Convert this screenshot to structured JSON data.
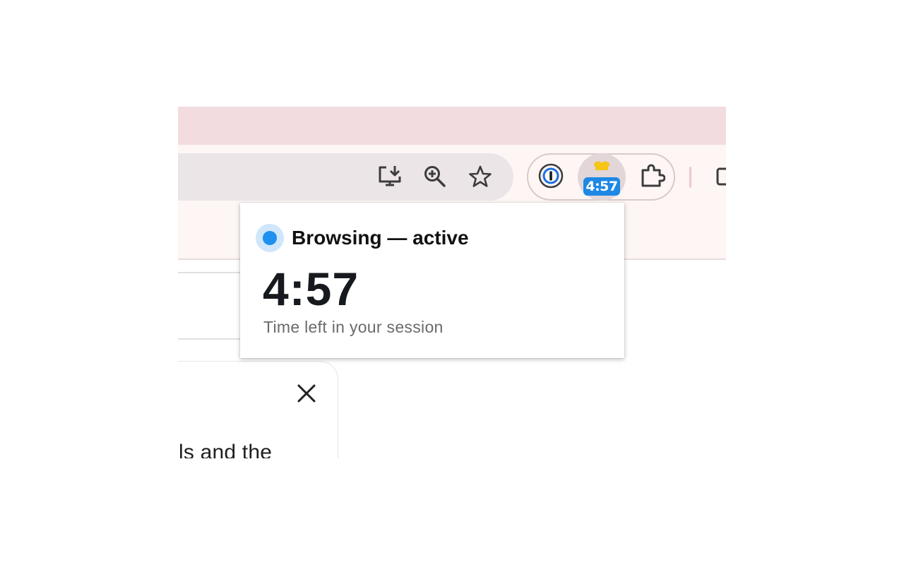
{
  "toolbar": {
    "icons": [
      "install-app-icon",
      "zoom-in-icon",
      "bookmark-star-icon"
    ],
    "extensions": [
      "1password-icon",
      "session-timer-extension",
      "extensions-puzzle-icon"
    ],
    "timer_badge": "4:57",
    "colors": {
      "tabstrip": "#f2dcdf",
      "toolbar": "#fdf6f5",
      "omnibox": "#ece5e8",
      "badge": "#1e88e5"
    }
  },
  "popup": {
    "status": "Browsing — active",
    "time_left": "4:57",
    "caption": "Time left in your session",
    "status_color": "#1e90f0"
  },
  "card": {
    "text": "ls and the"
  }
}
